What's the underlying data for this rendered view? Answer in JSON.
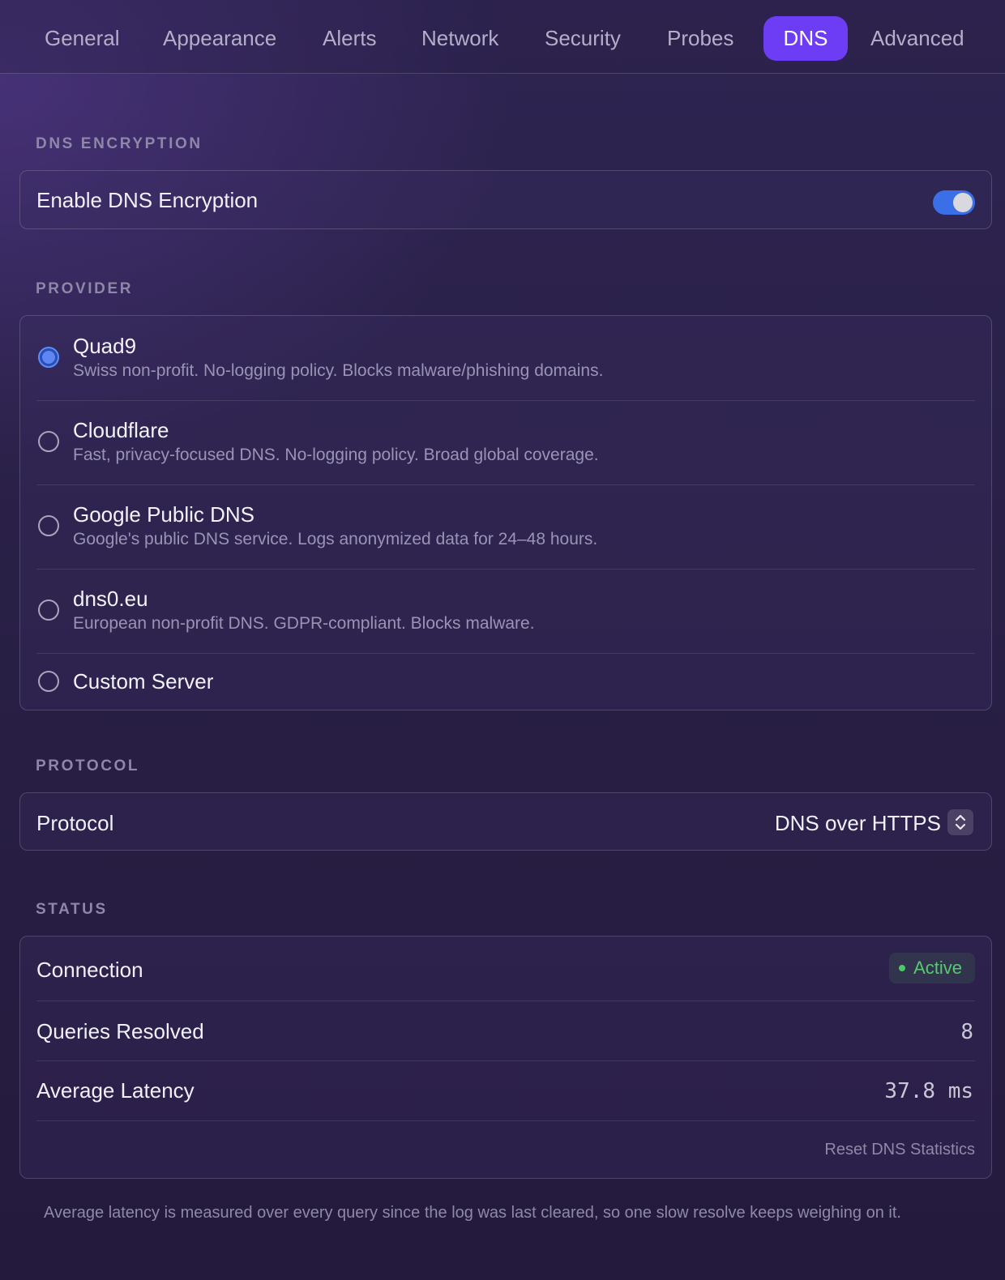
{
  "tabs": [
    {
      "label": "General"
    },
    {
      "label": "Appearance"
    },
    {
      "label": "Alerts"
    },
    {
      "label": "Network"
    },
    {
      "label": "Security"
    },
    {
      "label": "Probes"
    },
    {
      "label": "DNS",
      "active": true
    },
    {
      "label": "Advanced"
    }
  ],
  "dns_encryption": {
    "section_label": "DNS ENCRYPTION",
    "toggle_label": "Enable DNS Encryption",
    "enabled": true
  },
  "provider": {
    "section_label": "PROVIDER",
    "options": [
      {
        "name": "Quad9",
        "description": "Swiss non-profit. No-logging policy. Blocks malware/phishing domains.",
        "selected": true
      },
      {
        "name": "Cloudflare",
        "description": "Fast, privacy-focused DNS. No-logging policy. Broad global coverage.",
        "selected": false
      },
      {
        "name": "Google Public DNS",
        "description": "Google's public DNS service. Logs anonymized data for 24–48 hours.",
        "selected": false
      },
      {
        "name": "dns0.eu",
        "description": "European non-profit DNS. GDPR-compliant. Blocks malware.",
        "selected": false
      },
      {
        "name": "Custom Server",
        "description": "",
        "selected": false
      }
    ]
  },
  "protocol": {
    "section_label": "PROTOCOL",
    "label": "Protocol",
    "value": "DNS over HTTPS"
  },
  "status": {
    "section_label": "STATUS",
    "connection_label": "Connection",
    "connection_value": "Active",
    "queries_label": "Queries Resolved",
    "queries_value": "8",
    "latency_label": "Average Latency",
    "latency_value": "37.8 ms",
    "reset_label": "Reset DNS Statistics"
  },
  "footnote": "Average latency is measured over every query since the log was last cleared, so one slow resolve keeps weighing on it.",
  "colors": {
    "accent": "#6d3df5",
    "toggle_on": "#3a6fe8",
    "radio_selected": "#5f86f5",
    "status_active": "#57c96f"
  }
}
